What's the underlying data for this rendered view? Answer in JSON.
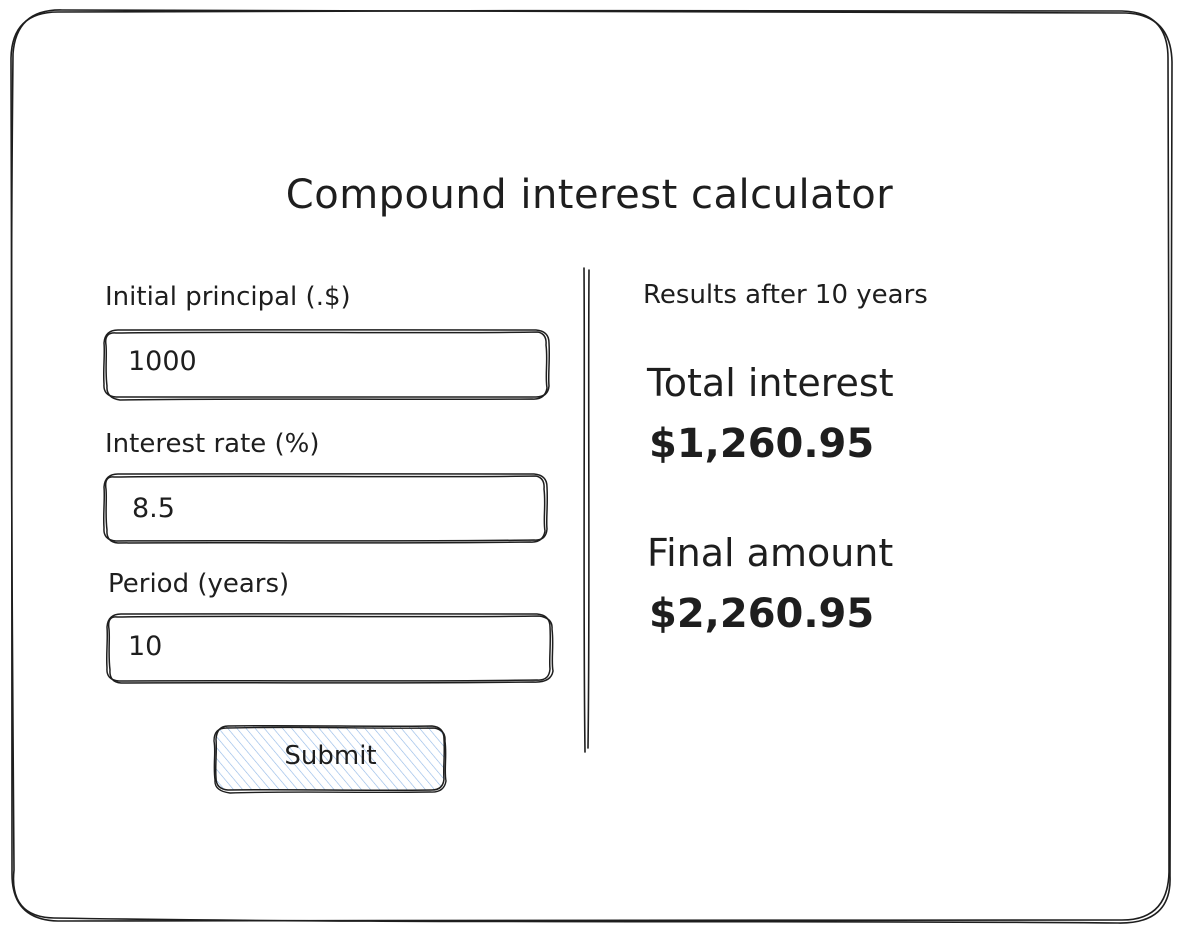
{
  "title": "Compound interest calculator",
  "form": {
    "principal": {
      "label": "Initial principal (.$)",
      "value": "1000"
    },
    "rate": {
      "label": "Interest rate (%)",
      "value": "8.5"
    },
    "period": {
      "label": "Period (years)",
      "value": "10"
    },
    "submit_label": "Submit"
  },
  "results": {
    "caption": "Results after 10 years",
    "total_interest": {
      "label": "Total interest",
      "value": "$1,260.95"
    },
    "final_amount": {
      "label": "Final amount",
      "value": "$2,260.95"
    }
  },
  "colors": {
    "stroke": "#1e1e1e",
    "button_fill": "#a5c8f0",
    "background": "#ffffff"
  }
}
